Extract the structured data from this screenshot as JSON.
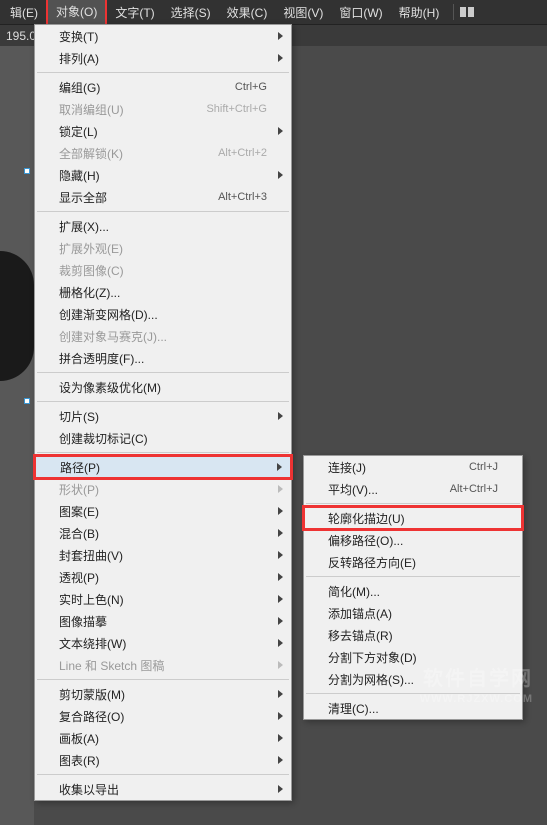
{
  "menubar": {
    "items": [
      "辑(E)",
      "对象(O)",
      "文字(T)",
      "选择(S)",
      "效果(C)",
      "视图(V)",
      "窗口(W)",
      "帮助(H)"
    ],
    "active_index": 1
  },
  "toolbar": {
    "left_readout": "195.0"
  },
  "dropdown": {
    "groups": [
      [
        {
          "label": "变换(T)",
          "submenu": true
        },
        {
          "label": "排列(A)",
          "submenu": true
        }
      ],
      [
        {
          "label": "编组(G)",
          "shortcut": "Ctrl+G"
        },
        {
          "label": "取消编组(U)",
          "shortcut": "Shift+Ctrl+G",
          "disabled": true
        },
        {
          "label": "锁定(L)",
          "submenu": true
        },
        {
          "label": "全部解锁(K)",
          "shortcut": "Alt+Ctrl+2",
          "disabled": true
        },
        {
          "label": "隐藏(H)",
          "submenu": true
        },
        {
          "label": "显示全部",
          "shortcut": "Alt+Ctrl+3"
        }
      ],
      [
        {
          "label": "扩展(X)..."
        },
        {
          "label": "扩展外观(E)",
          "disabled": true
        },
        {
          "label": "裁剪图像(C)",
          "disabled": true
        },
        {
          "label": "栅格化(Z)..."
        },
        {
          "label": "创建渐变网格(D)..."
        },
        {
          "label": "创建对象马赛克(J)...",
          "disabled": true
        },
        {
          "label": "拼合透明度(F)..."
        }
      ],
      [
        {
          "label": "设为像素级优化(M)"
        }
      ],
      [
        {
          "label": "切片(S)",
          "submenu": true
        },
        {
          "label": "创建裁切标记(C)"
        }
      ],
      [
        {
          "label": "路径(P)",
          "submenu": true,
          "highlighted": true,
          "boxed": true
        },
        {
          "label": "形状(P)",
          "submenu": true,
          "disabled": true
        },
        {
          "label": "图案(E)",
          "submenu": true
        },
        {
          "label": "混合(B)",
          "submenu": true
        },
        {
          "label": "封套扭曲(V)",
          "submenu": true
        },
        {
          "label": "透视(P)",
          "submenu": true
        },
        {
          "label": "实时上色(N)",
          "submenu": true
        },
        {
          "label": "图像描摹",
          "submenu": true
        },
        {
          "label": "文本绕排(W)",
          "submenu": true
        },
        {
          "label": "Line 和 Sketch 图稿",
          "submenu": true,
          "disabled": true
        }
      ],
      [
        {
          "label": "剪切蒙版(M)",
          "submenu": true
        },
        {
          "label": "复合路径(O)",
          "submenu": true
        },
        {
          "label": "画板(A)",
          "submenu": true
        },
        {
          "label": "图表(R)",
          "submenu": true
        }
      ],
      [
        {
          "label": "收集以导出",
          "submenu": true
        }
      ]
    ]
  },
  "submenu": {
    "groups": [
      [
        {
          "label": "连接(J)",
          "shortcut": "Ctrl+J"
        },
        {
          "label": "平均(V)...",
          "shortcut": "Alt+Ctrl+J"
        }
      ],
      [
        {
          "label": "轮廓化描边(U)",
          "boxed": true
        },
        {
          "label": "偏移路径(O)..."
        },
        {
          "label": "反转路径方向(E)"
        }
      ],
      [
        {
          "label": "简化(M)..."
        },
        {
          "label": "添加锚点(A)"
        },
        {
          "label": "移去锚点(R)"
        },
        {
          "label": "分割下方对象(D)"
        },
        {
          "label": "分割为网格(S)..."
        }
      ],
      [
        {
          "label": "清理(C)..."
        }
      ]
    ]
  },
  "watermark": {
    "line1": "软件自学网",
    "line2": "WWW.RJZXW.COM"
  }
}
